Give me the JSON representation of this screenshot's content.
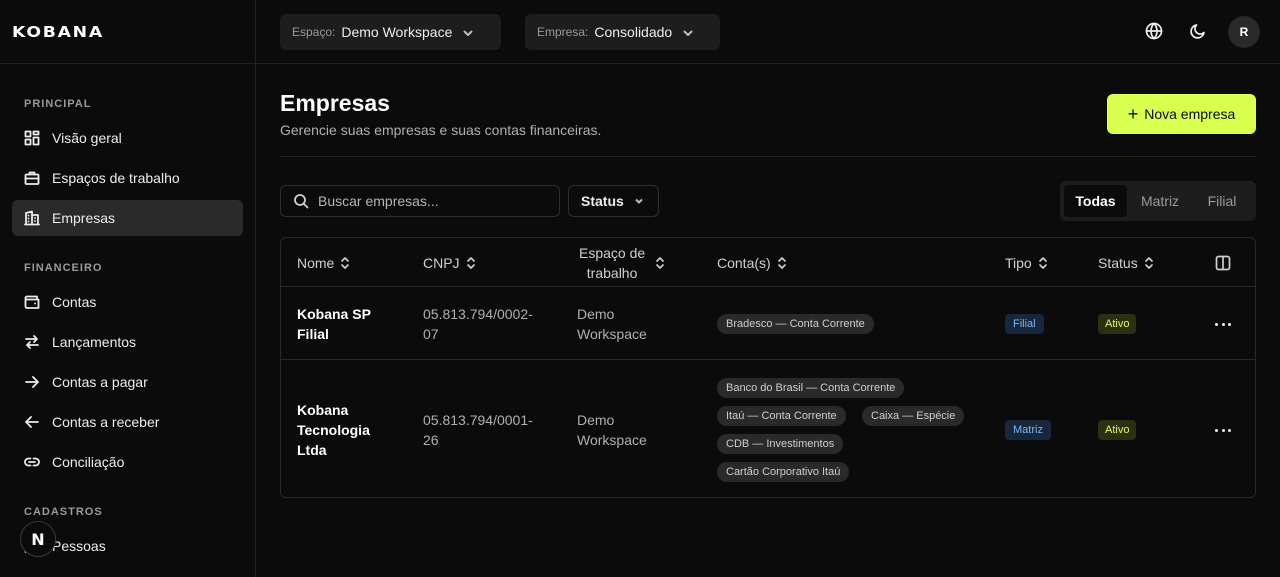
{
  "brand": {
    "logo_text": "KOBANA"
  },
  "sidebar": {
    "sections": [
      {
        "title": "PRINCIPAL"
      },
      {
        "title": "FINANCEIRO"
      },
      {
        "title": "CADASTROS"
      }
    ],
    "items": [
      {
        "label": "Visão geral",
        "icon": "dashboard-grid-icon"
      },
      {
        "label": "Espaços de trabalho",
        "icon": "briefcase-icon"
      },
      {
        "label": "Empresas",
        "icon": "building-icon",
        "active": true
      },
      {
        "label": "Contas",
        "icon": "wallet-icon"
      },
      {
        "label": "Lançamentos",
        "icon": "arrows-swap-icon"
      },
      {
        "label": "Contas a pagar",
        "icon": "arrow-right-icon"
      },
      {
        "label": "Contas a receber",
        "icon": "arrow-left-icon"
      },
      {
        "label": "Conciliação",
        "icon": "link-icon"
      },
      {
        "label": "Pessoas",
        "icon": "users-icon"
      }
    ],
    "n_badge": "N"
  },
  "topbar": {
    "workspace": {
      "label": "Espaço:",
      "value": "Demo Workspace"
    },
    "company": {
      "label": "Empresa:",
      "value": "Consolidado"
    },
    "avatar": "R"
  },
  "main": {
    "title": "Empresas",
    "subtitle": "Gerencie suas empresas e suas contas financeiras.",
    "new_button": "Nova empresa",
    "search_placeholder": "Buscar empresas...",
    "status_filter": "Status",
    "segments": [
      "Todas",
      "Matriz",
      "Filial"
    ],
    "active_segment": "Todas"
  },
  "table": {
    "headers": {
      "nome": "Nome",
      "cnpj": "CNPJ",
      "espaco_1": "Espaço de",
      "espaco_2": "trabalho",
      "contas": "Conta(s)",
      "tipo": "Tipo",
      "status": "Status"
    },
    "rows": [
      {
        "nome_1": "Kobana SP",
        "nome_2": "Filial",
        "cnpj_1": "05.813.794/0002-",
        "cnpj_2": "07",
        "espaco_1": "Demo",
        "espaco_2": "Workspace",
        "contas": [
          "Bradesco — Conta Corrente"
        ],
        "tipo": "Filial",
        "status": "Ativo"
      },
      {
        "nome_1": "Kobana",
        "nome_2": "Tecnologia",
        "nome_3": "Ltda",
        "cnpj_1": "05.813.794/0001-",
        "cnpj_2": "26",
        "espaco_1": "Demo",
        "espaco_2": "Workspace",
        "contas": [
          "Banco do Brasil — Conta Corrente",
          "Itaú — Conta Corrente",
          "Caixa — Espécie",
          "CDB — Investimentos",
          "Cartão Corporativo Itaú"
        ],
        "tipo": "Matriz",
        "status": "Ativo"
      }
    ]
  }
}
